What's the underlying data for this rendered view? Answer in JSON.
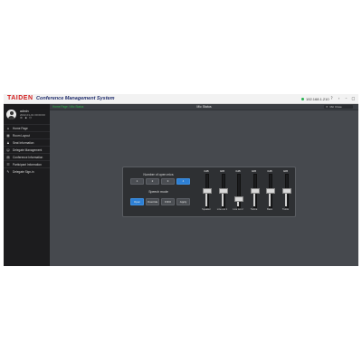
{
  "titlebar": {
    "logo": "TAIDEN",
    "title": "Conference Management System",
    "ip": "192.168.1.210",
    "status_color": "#22b14c",
    "window_buttons": [
      {
        "name": "help-icon",
        "glyph": "?"
      },
      {
        "name": "back-icon",
        "glyph": "‹"
      },
      {
        "name": "minimize-icon",
        "glyph": "–"
      },
      {
        "name": "maximize-icon",
        "glyph": "□"
      },
      {
        "name": "close-icon",
        "glyph": "×"
      }
    ]
  },
  "user": {
    "name": "admin",
    "subtitle": "2022-01-01 00:00:00",
    "icons": [
      {
        "name": "settings-icon",
        "glyph": "⚙"
      },
      {
        "name": "lock-icon",
        "glyph": "▪"
      },
      {
        "name": "logout-icon",
        "glyph": "⏻"
      }
    ]
  },
  "sidebar": {
    "items": [
      {
        "id": "home",
        "label": "Home Page",
        "icon": "home-icon",
        "glyph": "⌂"
      },
      {
        "id": "room-layout",
        "label": "Room Layout",
        "icon": "layout-icon",
        "glyph": "▦"
      },
      {
        "id": "seat-information",
        "label": "Seat Information",
        "icon": "seat-icon",
        "glyph": "♟"
      },
      {
        "id": "delegate-management",
        "label": "Delegate Management",
        "icon": "delegate-icon",
        "glyph": "☺"
      },
      {
        "id": "conference-information",
        "label": "Conference Information",
        "icon": "conference-icon",
        "glyph": "▤"
      },
      {
        "id": "participant-information",
        "label": "Participant Information",
        "icon": "participant-icon",
        "glyph": "☷"
      },
      {
        "id": "delegate-sign-in",
        "label": "Delegate Sign-in",
        "icon": "sign-in-icon",
        "glyph": "✎"
      }
    ]
  },
  "main": {
    "breadcrumb": "Home Page / Mic Status",
    "title": "Mic Status",
    "close_button": "Mic Close",
    "accent_color": "#2d7fd4"
  },
  "panel": {
    "mic_section_title": "Number of open mics",
    "mic_options": [
      "1",
      "2",
      "3",
      "4"
    ],
    "mic_active_index": 3,
    "speech_section_title": "Speech mode",
    "speech_modes": [
      "Open",
      "Override",
      "FIFO",
      "Apply"
    ],
    "speech_active_index": 0,
    "faders": [
      {
        "label": "Speaker",
        "value_text": "0dB",
        "level": 0.5
      },
      {
        "label": "Line out 1",
        "value_text": "0dB",
        "level": 0.5
      },
      {
        "label": "Line out 2",
        "value_text": "0dB",
        "level": 0.25
      },
      {
        "label": "Tieline",
        "value_text": "0dB",
        "level": 0.5
      },
      {
        "label": "Bass",
        "value_text": "0dB",
        "level": 0.5
      },
      {
        "label": "Treble",
        "value_text": "0dB",
        "level": 0.5
      }
    ]
  }
}
